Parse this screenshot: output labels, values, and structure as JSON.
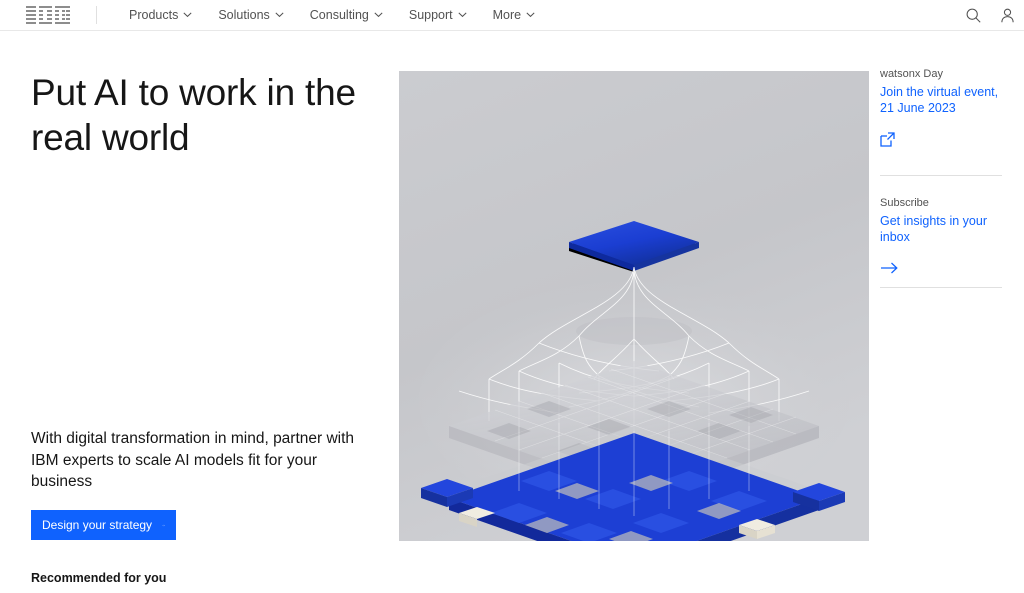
{
  "masthead": {
    "logo_alt": "IBM",
    "nav_items": [
      {
        "label": "Products",
        "caret": "chevron-down-icon"
      },
      {
        "label": "Solutions",
        "caret": "chevron-down-icon"
      },
      {
        "label": "Consulting",
        "caret": "chevron-down-icon"
      },
      {
        "label": "Support",
        "caret": "chevron-down-icon"
      },
      {
        "label": "More",
        "caret": "chevron-down-icon"
      }
    ],
    "search_icon": "search-icon",
    "account_icon": "user-profile-icon"
  },
  "hero": {
    "headline": "Put AI to work in the real world",
    "subhead": "With digital transformation in mind, partner with IBM experts to scale AI models fit for your business",
    "cta_label": "Design your strategy",
    "cta_icon": "arrow-right-icon",
    "image_alt": "3D isometric illustration of a blue puzzle-piece layer beneath a translucent grey grid layer, connected by white neural-network wireframes to a floating blue plate"
  },
  "recommended": {
    "title": "Recommended for you"
  },
  "rail": {
    "cards": [
      {
        "eyebrow": "watsonx Day",
        "link": "Join the virtual event, 21 June 2023",
        "icon": "external-link-icon"
      },
      {
        "eyebrow": "Subscribe",
        "link": "Get insights in your inbox",
        "icon": "arrow-right-icon"
      }
    ]
  },
  "colors": {
    "accent_blue": "#0f62fe",
    "text_primary": "#161616",
    "text_secondary": "#525252",
    "border": "#e0e0e0",
    "hero_bg": "#c7c8cc",
    "puzzle_blue": "#1d3fd4",
    "plate_blue": "#1b3fd6"
  }
}
